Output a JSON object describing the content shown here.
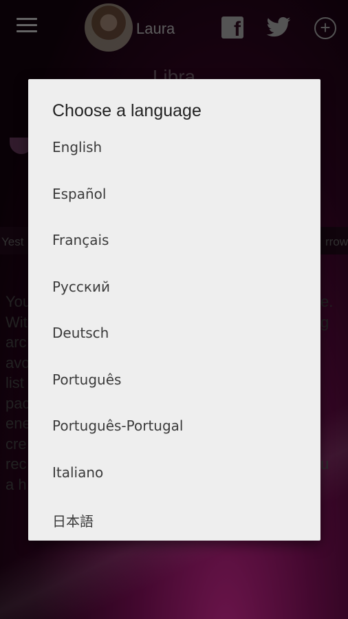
{
  "header": {
    "user_name": "Laura",
    "menu_icon": "hamburger-menu-icon",
    "facebook_icon": "facebook-icon",
    "twitter_icon": "twitter-icon",
    "add_icon": "add-circle-icon",
    "facebook_glyph": "f",
    "add_glyph": "+"
  },
  "background": {
    "sign_title": "Libra",
    "day_left": "Yest",
    "day_right": "rrow",
    "body_left": [
      "You",
      "Wit",
      "arc",
      "avo",
      "list",
      "pac",
      "ene",
      "cre",
      "rec",
      "a h"
    ],
    "body_right": [
      "e.",
      "g",
      "",
      "",
      "",
      "",
      "",
      "",
      "u",
      ""
    ]
  },
  "dialog": {
    "title": "Choose a language",
    "languages": [
      "English",
      "Español",
      "Français",
      "Русский",
      "Deutsch",
      "Português",
      "Português-Portugal",
      "Italiano",
      "日本語"
    ]
  },
  "colors": {
    "dialog_bg": "#eeeeee",
    "accent_magenta": "#c4278a"
  }
}
